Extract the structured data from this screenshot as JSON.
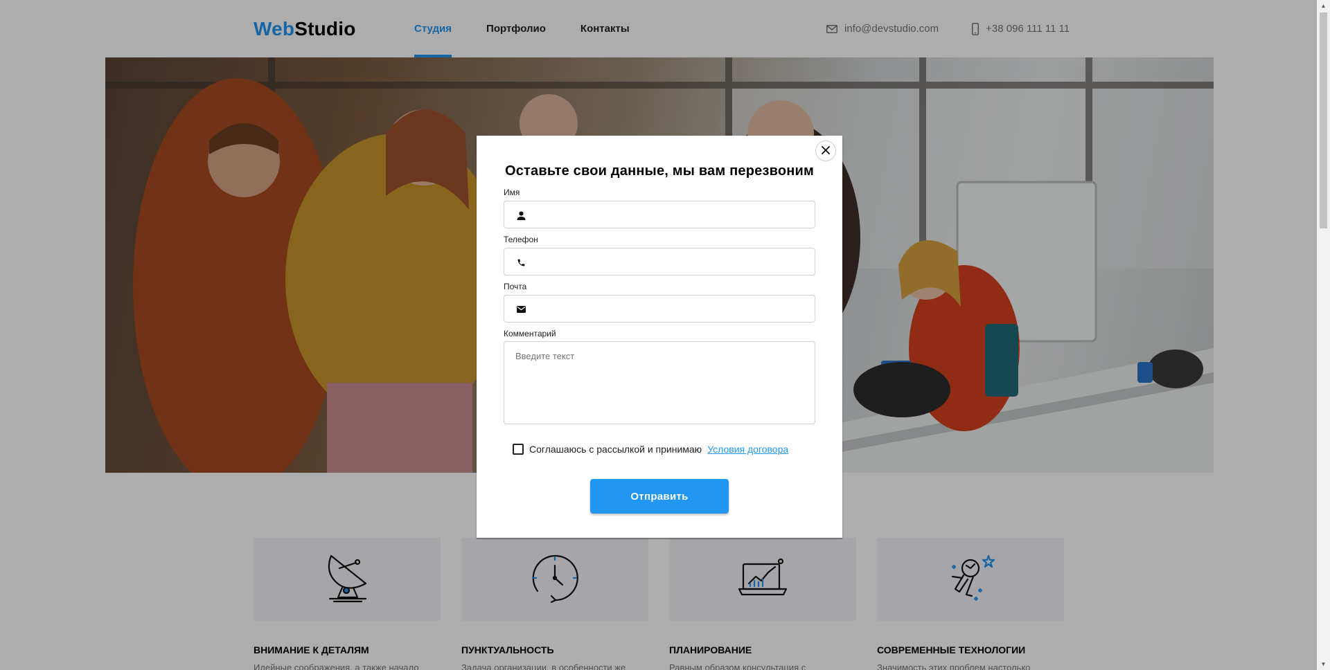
{
  "header": {
    "logo_part1": "Web",
    "logo_part2": "Studio",
    "nav": [
      {
        "label": "Студия",
        "active": true
      },
      {
        "label": "Портфолио",
        "active": false
      },
      {
        "label": "Контакты",
        "active": false
      }
    ],
    "email": "info@devstudio.com",
    "phone": "+38 096 111 11 11"
  },
  "features": [
    {
      "icon": "satellite-dish-icon",
      "title": "Внимание к деталям",
      "text": "Идейные соображения, а также начало"
    },
    {
      "icon": "clock-icon",
      "title": "Пунктуальность",
      "text": "Задача организации, в особенности же"
    },
    {
      "icon": "laptop-chart-icon",
      "title": "Планирование",
      "text": "Равным образом консультация с"
    },
    {
      "icon": "astronaut-icon",
      "title": "Современные технологии",
      "text": "Значимость этих проблем настолько"
    }
  ],
  "modal": {
    "title": "Оставьте свои данные, мы вам перезвоним",
    "name_label": "Имя",
    "phone_label": "Телефон",
    "email_label": "Почта",
    "comment_label": "Комментарий",
    "comment_placeholder": "Введите текст",
    "agree_text": "Соглашаюсь с рассылкой и принимаю",
    "agree_link": "Условия договора",
    "submit_label": "Отправить"
  },
  "colors": {
    "accent": "#2196f3",
    "text": "#212121",
    "muted": "#757575",
    "feature_bg": "#f5f4fa"
  }
}
